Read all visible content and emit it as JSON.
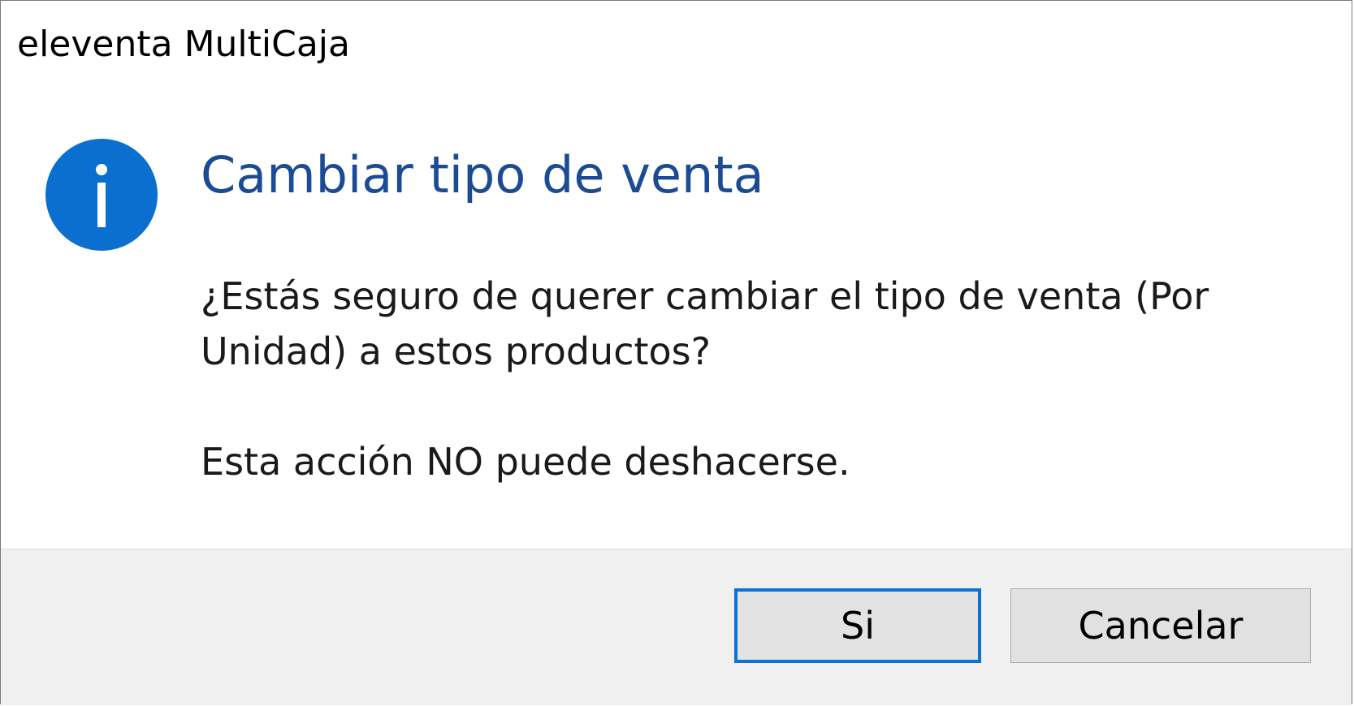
{
  "window": {
    "title": "eleventa MultiCaja"
  },
  "dialog": {
    "icon": "info-icon",
    "main_instruction": "Cambiar tipo de venta",
    "message_line1": "¿Estás seguro de querer cambiar el tipo de venta (Por",
    "message_line2": "Unidad) a estos productos?",
    "message_line3": "Esta acción NO puede deshacerse."
  },
  "buttons": {
    "yes_label": "Si",
    "cancel_label": "Cancelar"
  },
  "colors": {
    "accent": "#0a72d6",
    "instruction_text": "#1c4b95",
    "footer_bg": "#f0f0f0"
  }
}
